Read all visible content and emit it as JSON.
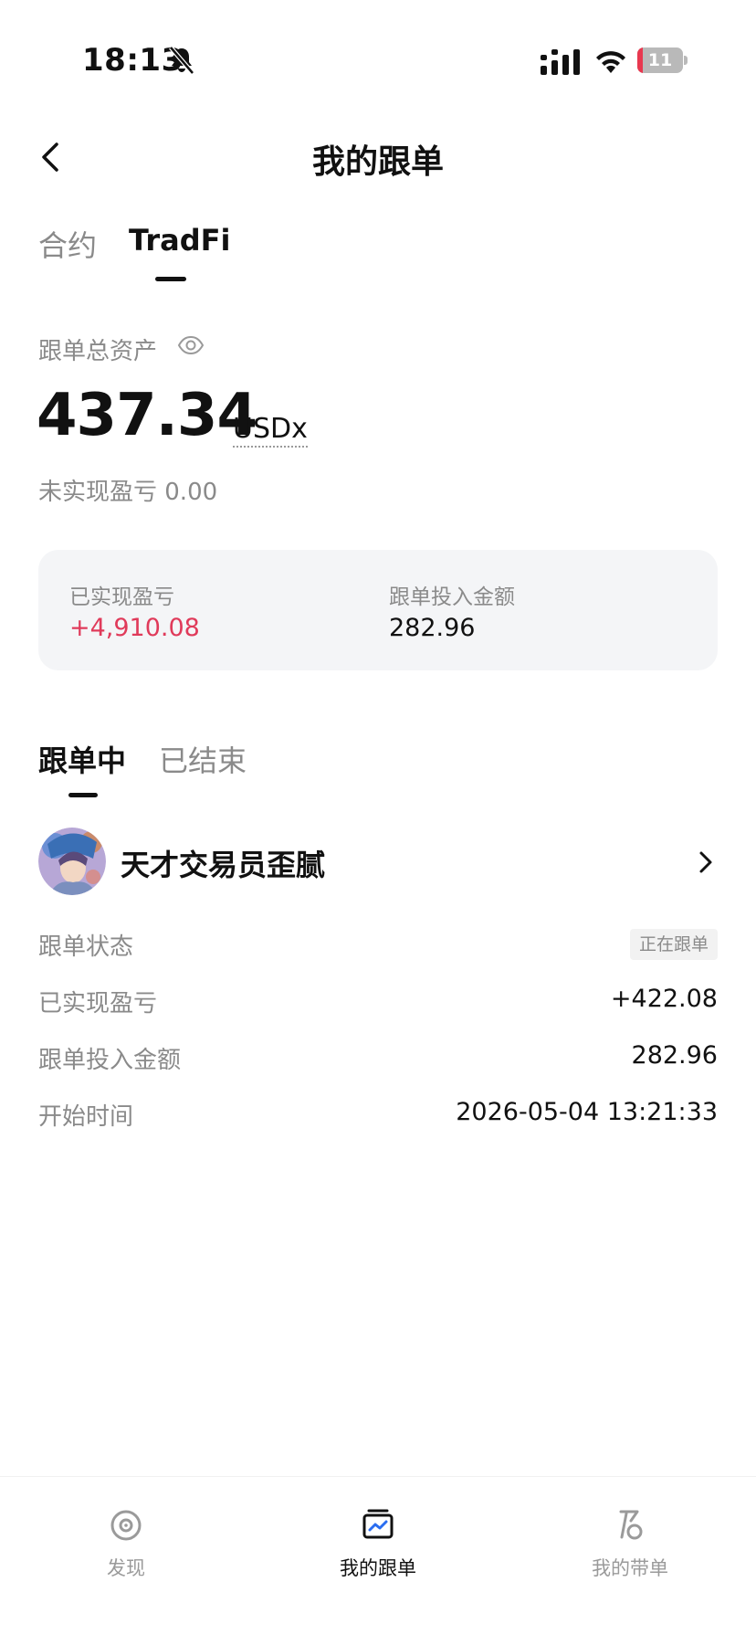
{
  "status_bar": {
    "time": "18:13",
    "icons": [
      "bell-muted-icon",
      "signal-icon",
      "wifi-icon",
      "battery-icon"
    ],
    "battery_level": "11",
    "battery_percent": 11,
    "battery_color": "#e8384f"
  },
  "header": {
    "title": "我的跟单",
    "back_icon": "chevron-left-icon"
  },
  "top_tabs": [
    {
      "label": "合约",
      "active": false
    },
    {
      "label": "TradFi",
      "active": true
    }
  ],
  "assets": {
    "label": "跟单总资产",
    "eye_icon": "eye-icon",
    "value": "437.34",
    "unit": "USDx",
    "unrealized": "未实现盈亏 0.00"
  },
  "summary": {
    "realized_label": "已实现盈亏",
    "realized_value": "+4,910.08",
    "invested_label": "跟单投入金额",
    "invested_value": "282.96"
  },
  "follow_tabs": [
    {
      "label": "跟单中",
      "active": true
    },
    {
      "label": "已结束",
      "active": false
    }
  ],
  "trader": {
    "name": "天才交易员歪腻",
    "details": [
      {
        "label": "跟单状态",
        "value": "正在跟单"
      },
      {
        "label": "已实现盈亏",
        "value": "+422.08"
      },
      {
        "label": "跟单投入金额",
        "value": "282.96"
      },
      {
        "label": "开始时间",
        "value": "2026-05-04 13:21:33"
      }
    ]
  },
  "bottom_nav": [
    {
      "label": "发现",
      "icon": "discover-icon",
      "active": false
    },
    {
      "label": "我的跟单",
      "icon": "copy-trade-icon",
      "active": true
    },
    {
      "label": "我的带单",
      "icon": "lead-trade-icon",
      "active": false
    }
  ],
  "colors": {
    "positive": "#e03a5a",
    "muted": "#8a8a8a",
    "card_bg": "#f4f5f7"
  }
}
